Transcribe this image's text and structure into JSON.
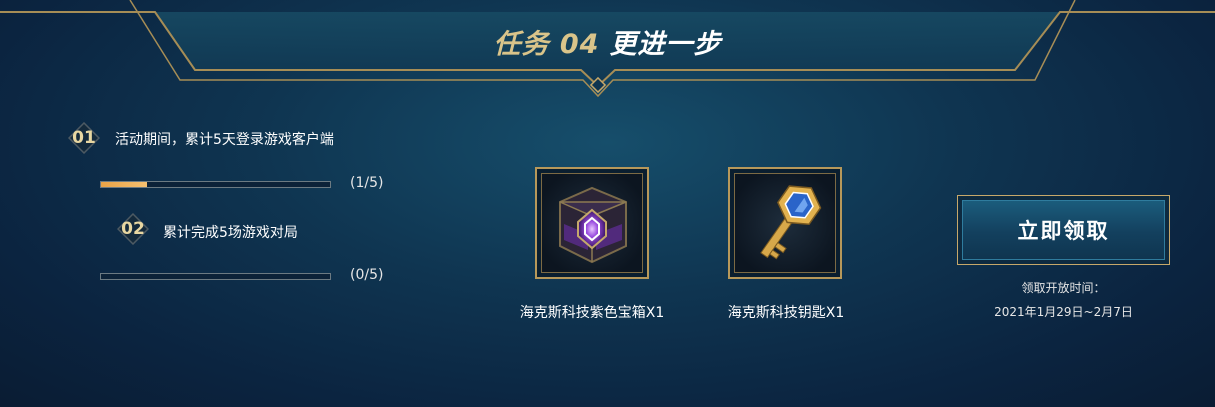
{
  "header": {
    "task_label": "任务 04",
    "task_name": "更进一步"
  },
  "tasks": [
    {
      "number": "01",
      "description": "活动期间，累计5天登录游戏客户端",
      "progress_text": "(1/5)",
      "progress_fraction": 0.2
    },
    {
      "number": "02",
      "description": "累计完成5场游戏对局",
      "progress_text": "(0/5)",
      "progress_fraction": 0.0
    }
  ],
  "rewards": [
    {
      "name": "海克斯科技紫色宝箱X1",
      "icon": "purple-hextech-chest-icon"
    },
    {
      "name": "海克斯科技钥匙X1",
      "icon": "hextech-key-icon"
    }
  ],
  "claim": {
    "button_label": "立即领取",
    "open_time_label": "领取开放时间：",
    "open_time_range": "2021年1月29日~2月7日"
  },
  "colors": {
    "accent_gold": "#c6a86a",
    "progress_orange": "#f0b460",
    "background_dark": "#0b2440"
  }
}
